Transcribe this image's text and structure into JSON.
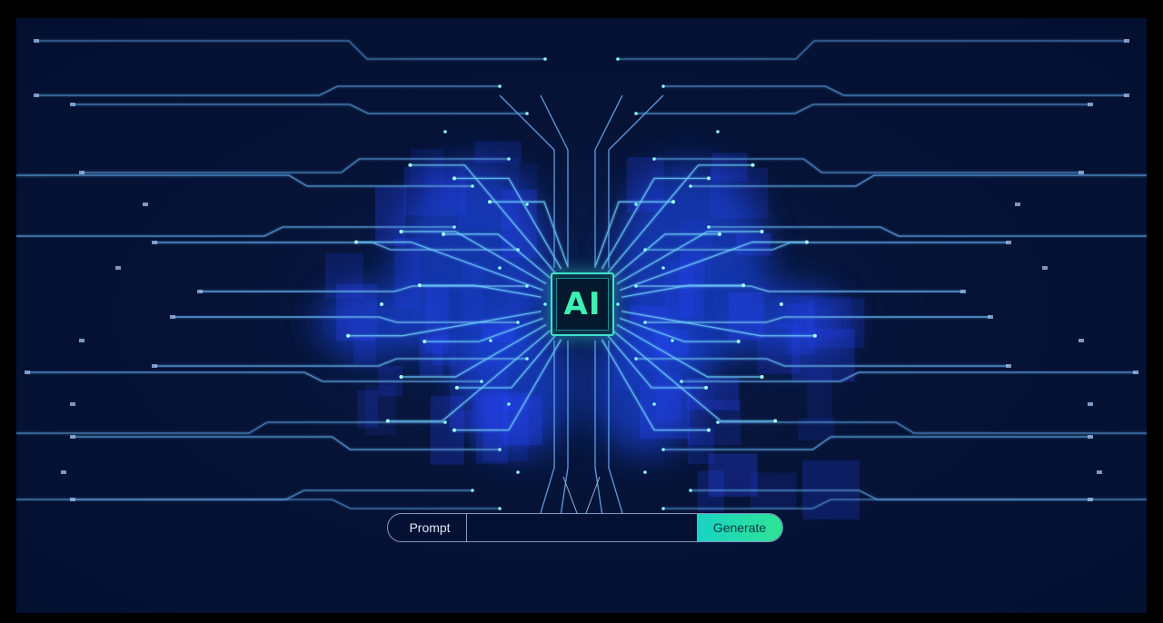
{
  "chip": {
    "label": "AI"
  },
  "prompt_bar": {
    "label": "Prompt",
    "input_value": "",
    "button_label": "Generate"
  },
  "colors": {
    "background": "#041030",
    "circuit_line": "#5fa8e6",
    "glow": "#1f4dff",
    "accent": "#3ef0b4"
  },
  "icons": {
    "chip": "ai-chip-icon",
    "circuit": "circuit-board-icon"
  }
}
